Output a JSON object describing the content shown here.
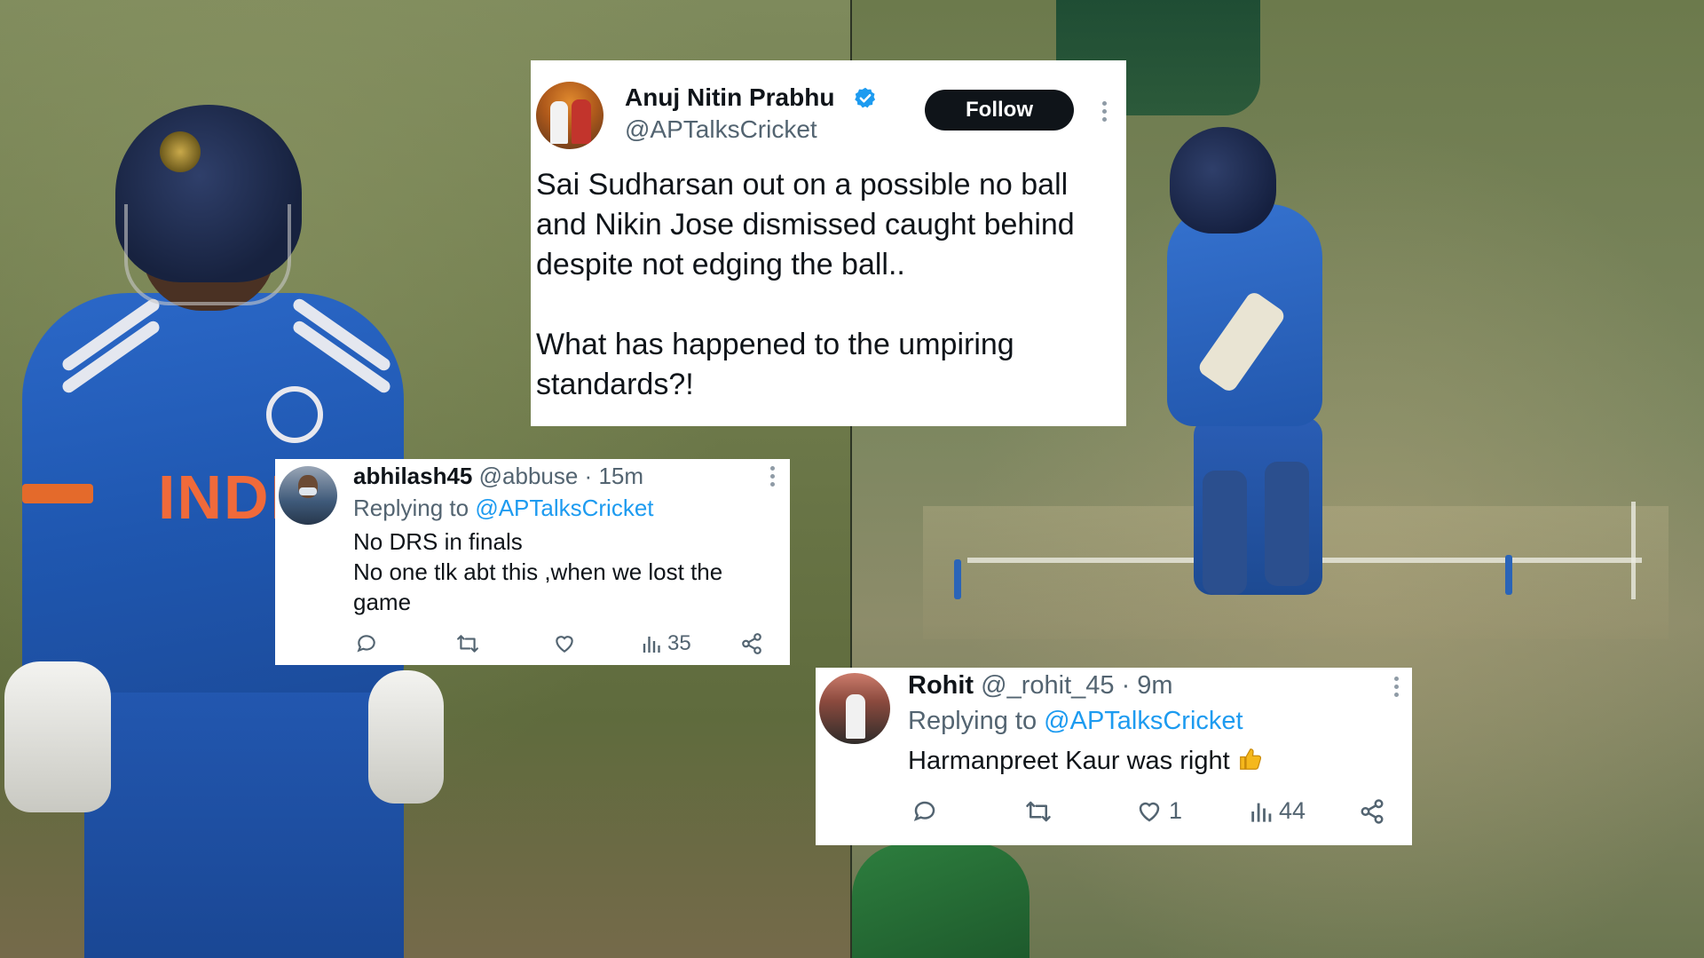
{
  "main_tweet": {
    "name": "Anuj Nitin Prabhu",
    "handle": "@APTalksCricket",
    "follow_label": "Follow",
    "text_paragraphs": [
      "Sai Sudharsan out on a possible no ball and Nikin Jose dismissed caught behind despite not edging the ball..",
      "What has happened to the umpiring standards?!"
    ],
    "icons": {
      "verified": "verified-badge-icon",
      "more": "more-options-icon"
    }
  },
  "reply_1": {
    "name": "abhilash45",
    "meta": "@abbuse · 15m",
    "replying_prefix": "Replying to ",
    "replying_handle": "@APTalksCricket",
    "lines": [
      "No DRS in finals",
      "No one tlk abt this ,when we lost the",
      "game"
    ],
    "views": "35",
    "icons": [
      "reply-icon",
      "retweet-icon",
      "like-icon",
      "views-icon",
      "share-icon"
    ]
  },
  "reply_2": {
    "name": "Rohit",
    "meta": "@_rohit_45 · 9m",
    "replying_prefix": "Replying to ",
    "replying_handle": "@APTalksCricket",
    "text": "Harmanpreet Kaur was right",
    "emoji": "thumbs-up-emoji",
    "likes": "1",
    "views": "44",
    "icons": [
      "reply-icon",
      "retweet-icon",
      "like-icon",
      "views-icon",
      "share-icon"
    ]
  },
  "background": {
    "left_photo": "India batsman in blue jersey with INDIA lettering",
    "jersey_text": "INDI",
    "right_photo": "India batsman playing a shot on the pitch"
  },
  "colors": {
    "link": "#1d9bf0",
    "verified": "#1d9bf0",
    "follow_bg": "#0f1419",
    "secondary_text": "#536471",
    "jersey_blue": "#2b68c8",
    "jersey_orange": "#f06a3a"
  }
}
